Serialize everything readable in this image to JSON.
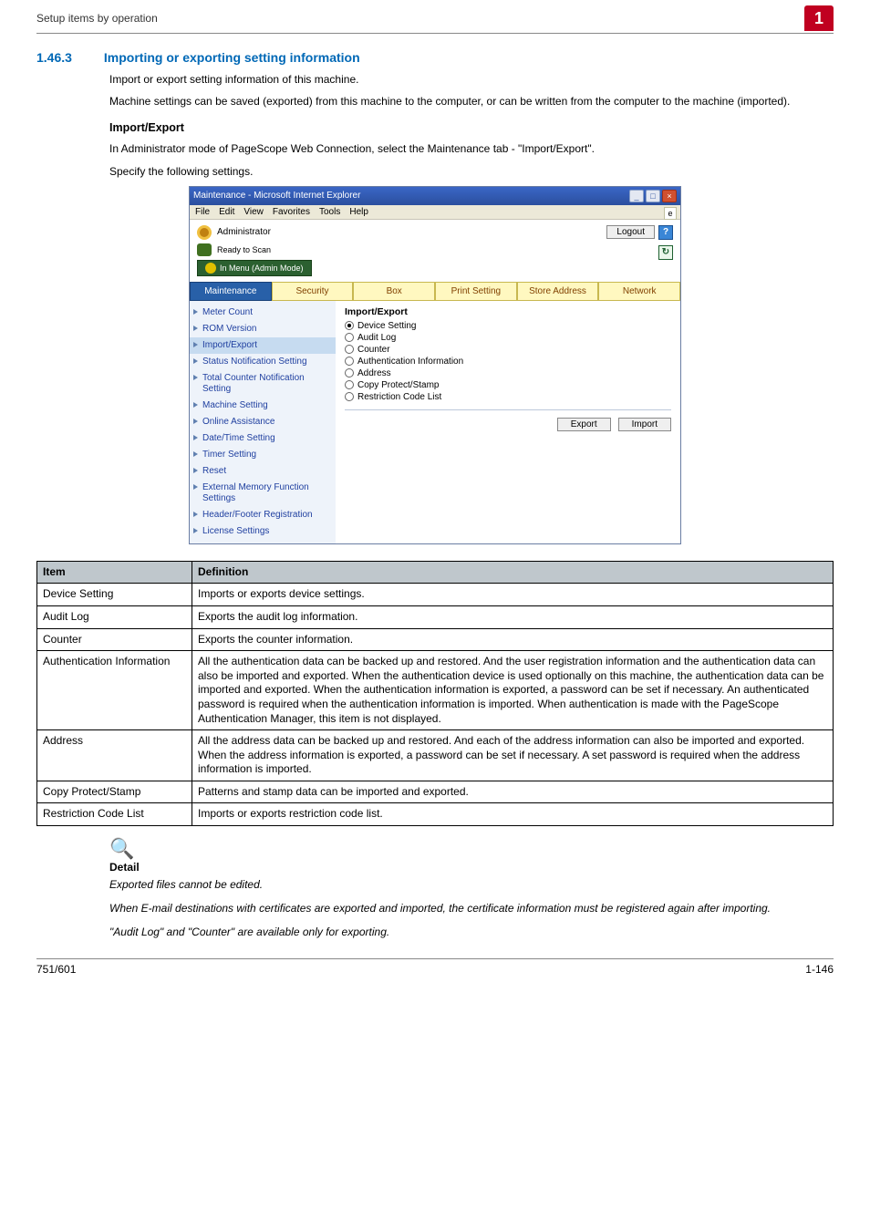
{
  "header": {
    "breadcrumb": "Setup items by operation",
    "badge": "1"
  },
  "section": {
    "number": "1.46.3",
    "title": "Importing or exporting setting information",
    "intro1": "Import or export setting information of this machine.",
    "intro2": "Machine settings can be saved (exported) from this machine to the computer, or can be written from the computer to the machine (imported)."
  },
  "importexport": {
    "heading": "Import/Export",
    "p1": "In Administrator mode of PageScope Web Connection, select the Maintenance tab - \"Import/Export\".",
    "p2": "Specify the following settings."
  },
  "browser": {
    "title": "Maintenance - Microsoft Internet Explorer",
    "menus": [
      "File",
      "Edit",
      "View",
      "Favorites",
      "Tools",
      "Help"
    ],
    "adminLabel": "Administrator",
    "readyLabel": "Ready to Scan",
    "menuMode": "In Menu (Admin Mode)",
    "logout": "Logout",
    "helpGlyph": "?",
    "refreshGlyph": "↻",
    "tabs": [
      "Maintenance",
      "Security",
      "Box",
      "Print Setting",
      "Store Address",
      "Network"
    ],
    "activeTabIndex": 0,
    "sidebar": [
      "Meter Count",
      "ROM Version",
      "Import/Export",
      "Status Notification Setting",
      "Total Counter Notification Setting",
      "Machine Setting",
      "Online Assistance",
      "Date/Time Setting",
      "Timer Setting",
      "Reset",
      "External Memory Function Settings",
      "Header/Footer Registration",
      "License Settings"
    ],
    "sidebarActiveIndex": 2,
    "mainTitle": "Import/Export",
    "radios": [
      "Device Setting",
      "Audit Log",
      "Counter",
      "Authentication Information",
      "Address",
      "Copy Protect/Stamp",
      "Restriction Code List"
    ],
    "radioSelectedIndex": 0,
    "buttons": {
      "export": "Export",
      "import": "Import"
    }
  },
  "table": {
    "head": {
      "item": "Item",
      "def": "Definition"
    },
    "rows": [
      {
        "item": "Device Setting",
        "def": "Imports or exports device settings."
      },
      {
        "item": "Audit Log",
        "def": "Exports the audit log information."
      },
      {
        "item": "Counter",
        "def": "Exports the counter information."
      },
      {
        "item": "Authentication Information",
        "def": "All the authentication data can be backed up and restored.\nAnd the user registration information and the authentication data can also be imported and exported.\nWhen the authentication device is used optionally on this machine, the authentication data can be imported and exported.\nWhen the authentication information is exported, a password can be set if necessary. An authenticated password is required when the authentication information is imported. When authentication is made with the PageScope Authentication Manager, this item is not displayed."
      },
      {
        "item": "Address",
        "def": "All the address data can be backed up and restored. And each of the address information can also be imported and exported.\nWhen the address information is exported, a password can be set if necessary.\nA set password is required when the address information is imported."
      },
      {
        "item": "Copy Protect/Stamp",
        "def": "Patterns and stamp data can be imported and exported."
      },
      {
        "item": "Restriction Code List",
        "def": "Imports or exports restriction code list."
      }
    ]
  },
  "detail": {
    "mark": "🔍",
    "title": "Detail",
    "p1": "Exported files cannot be edited.",
    "p2": "When E-mail destinations with certificates are exported and imported, the certificate information must be registered again after importing.",
    "p3": "\"Audit Log\" and \"Counter\" are available only for exporting."
  },
  "footer": {
    "left": "751/601",
    "right": "1-146"
  }
}
